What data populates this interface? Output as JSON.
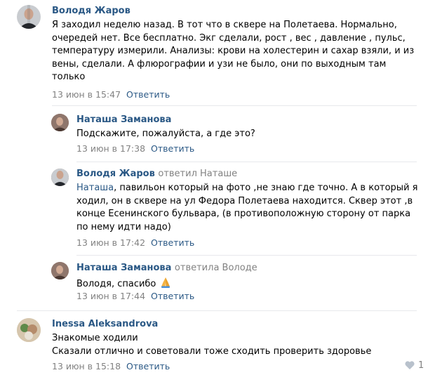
{
  "comments": [
    {
      "author": "Володя Жаров",
      "text_lines": [
        "Я заходил неделю назад. В тот что в сквере на Полетаева. Нормально,",
        "очередей нет. Все бесплатно. Экг сделали, рост , вес , давление , пульс,",
        "температуру измерили. Анализы: крови на холестерин и сахар взяли, и из",
        "вены, сделали. А флюрографии и узи не было, они по выходным там",
        "только"
      ],
      "date": "13 июн в 15:47",
      "reply_label": "Ответить"
    },
    {
      "author": "Наташа Заманова",
      "text_lines": [
        "Подскажите, пожалуйста, а где это?"
      ],
      "date": "13 июн в 17:38",
      "reply_label": "Ответить"
    },
    {
      "author": "Володя Жаров",
      "replied_to": "ответил Наташе",
      "addressee": "Наташа",
      "text_first_rest": ", павильон который на фото ,не знаю где точно. А в который я",
      "text_lines": [
        "ходил, он в сквере на ул Федора Полетаева находится. Сквер этот ,в",
        "конце Есенинского бульвара, (в противоположную сторону от парка",
        "по нему идти надо)"
      ],
      "date": "13 июн в 17:42",
      "reply_label": "Ответить"
    },
    {
      "author": "Наташа Заманова",
      "replied_to": "ответила Володе",
      "text": "Володя, спасибо",
      "emoji": "folded-hands-icon",
      "date": "13 июн в 17:44",
      "reply_label": "Ответить"
    },
    {
      "author": "Inessa Aleksandrova",
      "text_lines": [
        "Знакомые ходили",
        "Сказали отлично и советовали тоже сходить проверить здоровье"
      ],
      "date": "13 июн в 15:18",
      "reply_label": "Ответить",
      "likes": "1"
    }
  ]
}
